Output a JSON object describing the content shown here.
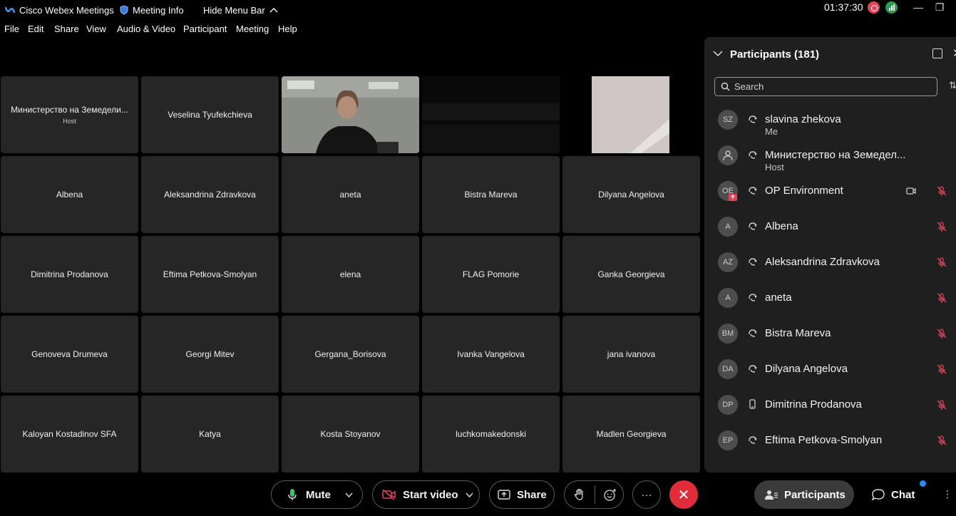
{
  "titlebar": {
    "app_title": "Cisco Webex Meetings",
    "meeting_info": "Meeting Info",
    "hide_menu": "Hide Menu Bar",
    "clock": "01:37:30",
    "minimize": "—",
    "restore": "❐"
  },
  "menu": [
    "File",
    "Edit",
    "Share",
    "View",
    "Audio & Video",
    "Participant",
    "Meeting",
    "Help"
  ],
  "grid": {
    "host_name": "Министерство на Земедели...",
    "host_role": "Host",
    "tiles": [
      "Veselina Tyufekchieva",
      "Albena",
      "Aleksandrina Zdravkova",
      "aneta",
      "Bistra Mareva",
      "Dilyana Angelova",
      "Dimitrina Prodanova",
      "Eftima Petkova-Smolyan",
      "elena",
      "FLAG Pomorie",
      "Ganka Georgieva",
      "Genoveva Drumeva",
      "Georgi Mitev",
      "Gergana_Borisova",
      "Ivanka Vangelova",
      "jana ivanova",
      "Kaloyan Kostadinov SFA",
      "Katya",
      "Kosta Stoyanov",
      "luchkomakedonski",
      "Madlen Georgieva"
    ]
  },
  "panel": {
    "title": "Participants (181)",
    "search_placeholder": "Search",
    "participants": [
      {
        "initials": "SZ",
        "name": "slavina zhekova",
        "role": "Me"
      },
      {
        "initials": "",
        "name": "Министерство на Земедел...",
        "role": "Host"
      },
      {
        "initials": "OE",
        "name": "OP Environment",
        "role": ""
      },
      {
        "initials": "A",
        "name": "Albena",
        "role": ""
      },
      {
        "initials": "AZ",
        "name": "Aleksandrina Zdravkova",
        "role": ""
      },
      {
        "initials": "A",
        "name": "aneta",
        "role": ""
      },
      {
        "initials": "BM",
        "name": "Bistra Mareva",
        "role": ""
      },
      {
        "initials": "DA",
        "name": "Dilyana Angelova",
        "role": ""
      },
      {
        "initials": "DP",
        "name": "Dimitrina Prodanova",
        "role": ""
      },
      {
        "initials": "EP",
        "name": "Eftima Petkova-Smolyan",
        "role": ""
      }
    ]
  },
  "controls": {
    "mute": "Mute",
    "start_video": "Start video",
    "share": "Share",
    "end_icon": "✕",
    "more": "···",
    "participants": "Participants",
    "chat": "Chat"
  },
  "colors": {
    "end_call": "#e02d3c",
    "recording": "#e0455a",
    "notification": "#2a8cf0"
  }
}
